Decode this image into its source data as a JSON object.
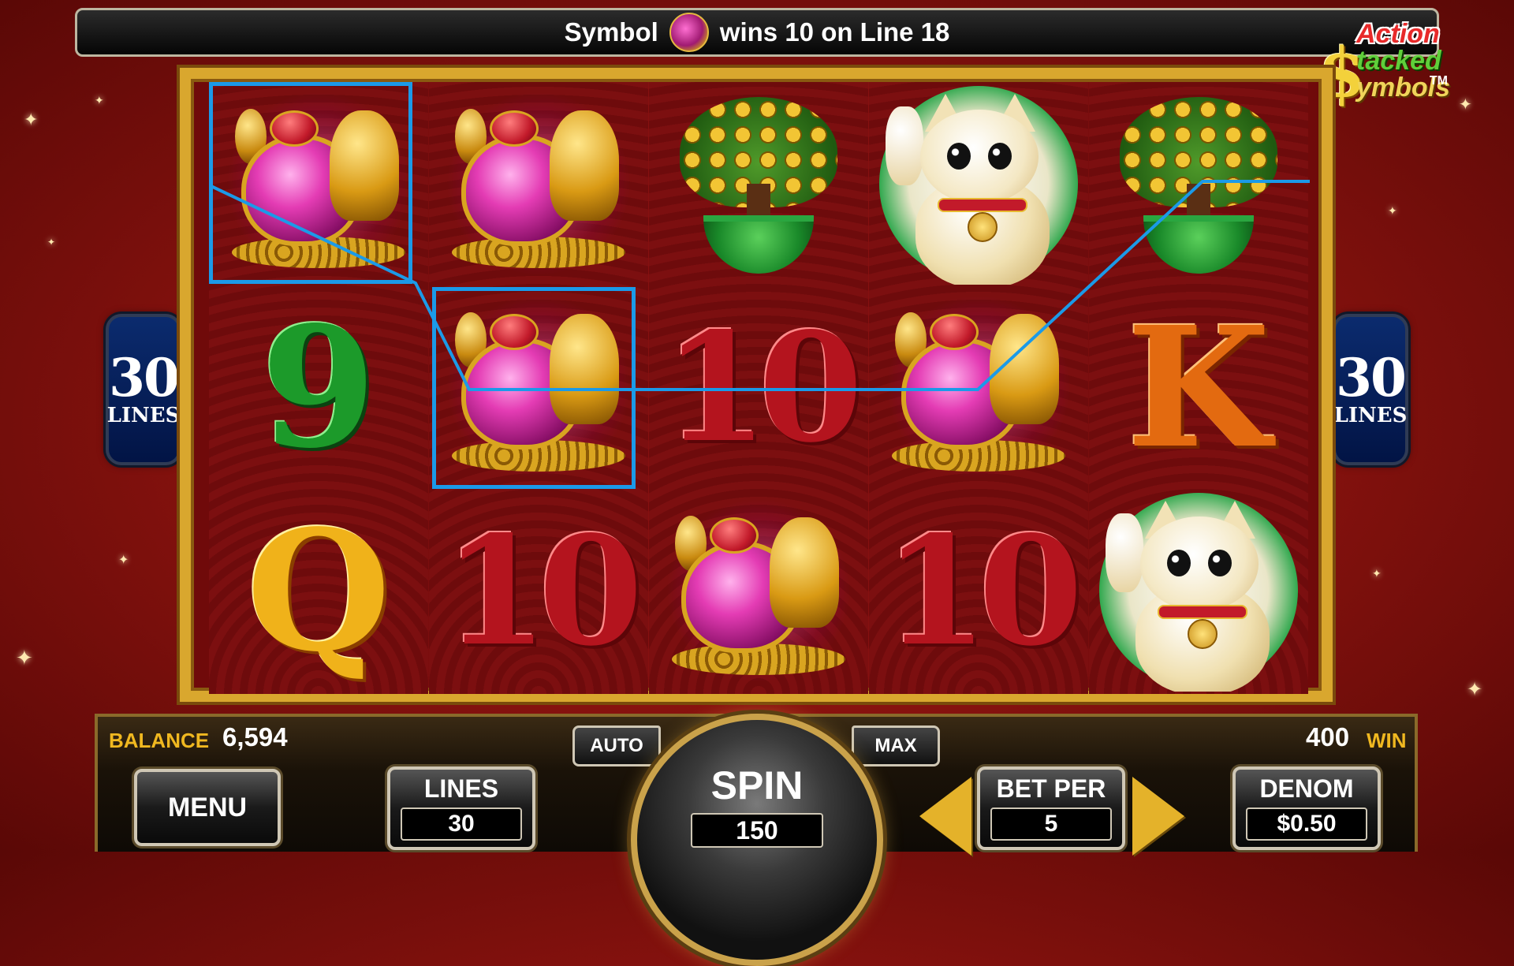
{
  "message": {
    "prefix": "Symbol",
    "symbol_icon": "turtle-symbol-icon",
    "suffix": "wins 10 on Line 18"
  },
  "logo": {
    "line1": "Action",
    "line2": "tacked",
    "line3": "ymbols",
    "dollar": "$",
    "trademark": "TM"
  },
  "side_badges": {
    "left": {
      "number": "30",
      "label": "LINES"
    },
    "right": {
      "number": "30",
      "label": "LINES"
    }
  },
  "reels": [
    [
      "turtle",
      "9",
      "Q"
    ],
    [
      "turtle",
      "turtle",
      "10"
    ],
    [
      "money-tree",
      "10",
      "turtle"
    ],
    [
      "lucky-cat",
      "turtle",
      "10"
    ],
    [
      "money-tree",
      "K",
      "lucky-cat"
    ]
  ],
  "winning_line": {
    "line": 18,
    "positions": [
      "reel1-row1",
      "reel2-row2"
    ],
    "color": "#1b9ae8"
  },
  "panel": {
    "balance_label": "BALANCE",
    "balance_value": "6,594",
    "win_value": "400",
    "win_label": "WIN",
    "menu_label": "MENU",
    "auto_label": "AUTO",
    "max_label": "MAX",
    "spin_label": "SPIN",
    "spin_value": "150",
    "lines_label": "LINES",
    "lines_value": "30",
    "bet_label": "BET PER",
    "bet_value": "5",
    "denom_label": "DENOM",
    "denom_value": "$0.50"
  },
  "colors": {
    "accent_gold": "#f0b820",
    "highlight_blue": "#1b9ae8",
    "background_red": "#8a130f"
  }
}
